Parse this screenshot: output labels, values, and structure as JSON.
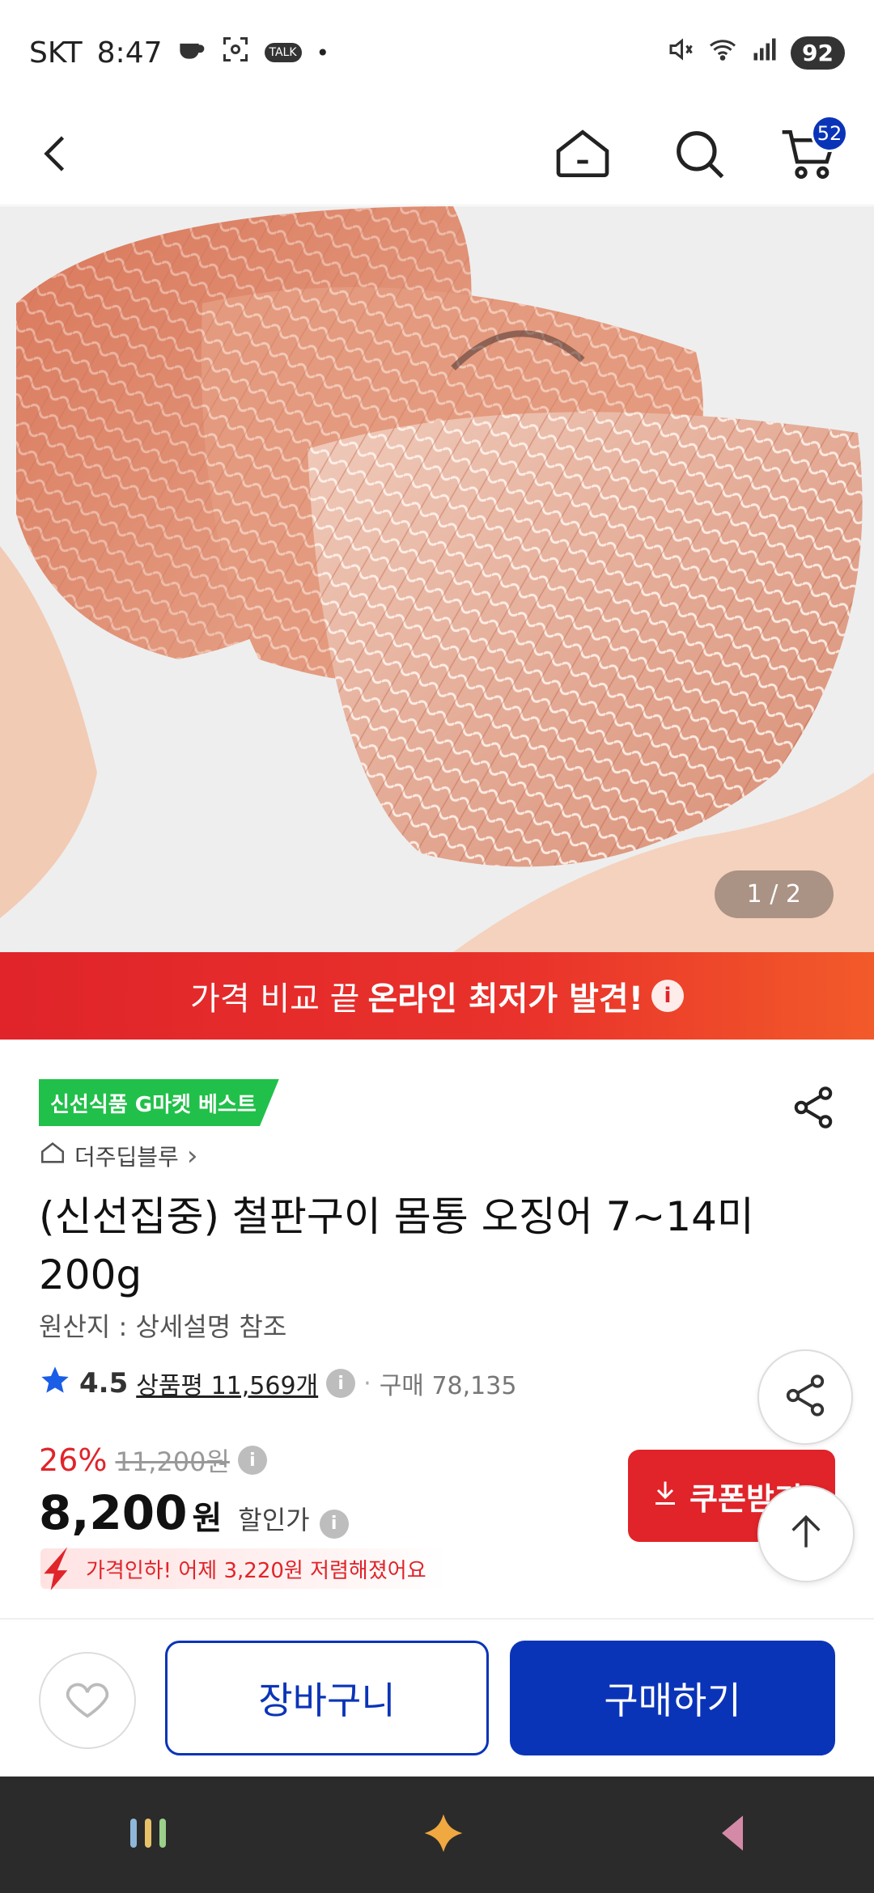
{
  "status_bar": {
    "carrier": "SKT",
    "time": "8:47",
    "battery": "92",
    "talk_label": "TALK"
  },
  "nav": {
    "cart_count": "52"
  },
  "image": {
    "counter": "1 / 2"
  },
  "promo": {
    "text_normal": "가격 비교 끝",
    "text_strong": "온라인 최저가 발견!",
    "info": "i"
  },
  "product": {
    "best_badge": "신선식품 G마켓 베스트",
    "seller": "더주딥블루",
    "seller_chevron": "›",
    "title": "(신선집중) 철판구이 몸통 오징어 7~14미 200g",
    "origin": "원산지 : 상세설명 참조",
    "rating": "4.5",
    "review_label": "상품평 11,569개",
    "purchase_label": "구매 78,135",
    "discount_rate": "26%",
    "original_price": "11,200원",
    "price": "8,200",
    "price_unit": "원",
    "price_label": "할인가",
    "drop_note": "가격인하! 어제 3,220원 저렴해졌어요",
    "coupon_label": "쿠폰받기"
  },
  "actions": {
    "cart_label": "장바구니",
    "buy_label": "구매하기"
  },
  "colors": {
    "brand_blue": "#0a34b8",
    "accent_red": "#e0242a",
    "best_green": "#21c04a"
  },
  "icons": [
    "back-icon",
    "home-icon",
    "search-icon",
    "cart-icon",
    "share-icon",
    "star-icon",
    "heart-icon",
    "arrow-up-icon",
    "download-icon"
  ]
}
